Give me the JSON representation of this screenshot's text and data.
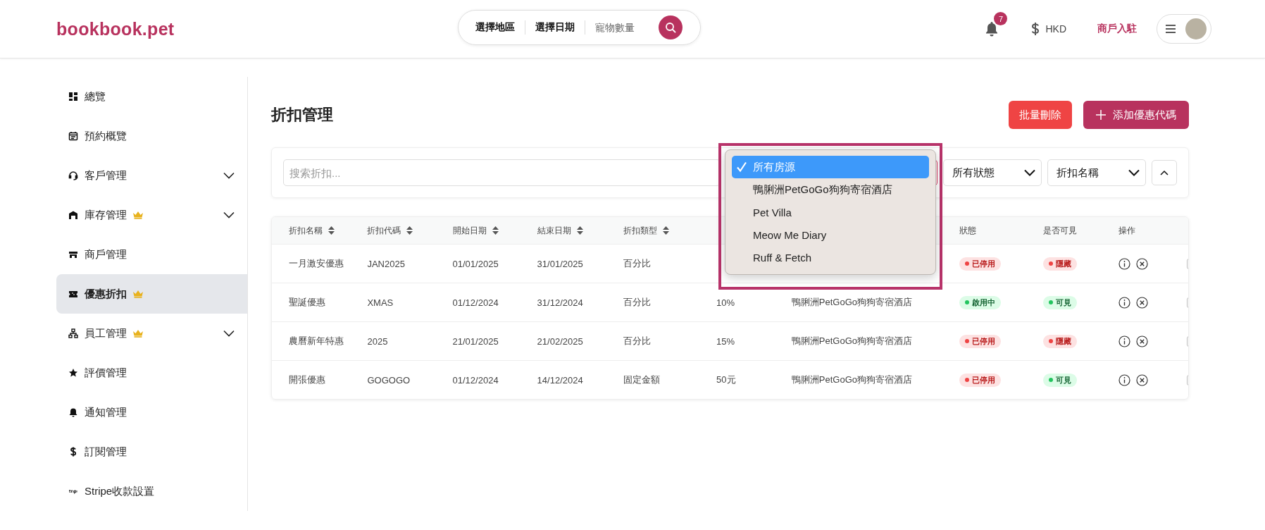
{
  "header": {
    "logo": "bookbook.pet",
    "search": {
      "region": "選擇地區",
      "date": "選擇日期",
      "pets_placeholder": "寵物數量"
    },
    "notifications": {
      "count": "7"
    },
    "currency": "HKD",
    "merchant_link": "商戶入駐"
  },
  "sidebar": {
    "items": [
      {
        "label": "總覽",
        "premium": false,
        "expandable": false,
        "selected": false
      },
      {
        "label": "預約概覽",
        "premium": false,
        "expandable": false,
        "selected": false
      },
      {
        "label": "客戶管理",
        "premium": false,
        "expandable": true,
        "selected": false
      },
      {
        "label": "庫存管理",
        "premium": true,
        "expandable": true,
        "selected": false
      },
      {
        "label": "商戶管理",
        "premium": false,
        "expandable": false,
        "selected": false
      },
      {
        "label": "優惠折扣",
        "premium": true,
        "expandable": false,
        "selected": true
      },
      {
        "label": "員工管理",
        "premium": true,
        "expandable": true,
        "selected": false
      },
      {
        "label": "評價管理",
        "premium": false,
        "expandable": false,
        "selected": false
      },
      {
        "label": "通知管理",
        "premium": false,
        "expandable": false,
        "selected": false
      },
      {
        "label": "訂閱管理",
        "premium": false,
        "expandable": false,
        "selected": false
      },
      {
        "label": "Stripe收款設置",
        "premium": false,
        "expandable": false,
        "selected": false
      }
    ]
  },
  "page": {
    "title": "折扣管理",
    "bulk_delete_button": "批量刪除",
    "add_button": "添加優惠代碼"
  },
  "filters": {
    "search_placeholder": "搜索折扣...",
    "status_select": "所有狀態",
    "sort_select": "折扣名稱"
  },
  "property_dropdown": {
    "options": [
      {
        "label": "所有房源",
        "selected": true
      },
      {
        "label": "鴨脷洲PetGoGo狗狗寄宿酒店",
        "selected": false
      },
      {
        "label": "Pet Villa",
        "selected": false
      },
      {
        "label": "Meow Me Diary",
        "selected": false
      },
      {
        "label": "Ruff & Fetch",
        "selected": false
      }
    ]
  },
  "table": {
    "columns": [
      {
        "label": "折扣名稱",
        "sortable": true
      },
      {
        "label": "折扣代碼",
        "sortable": true
      },
      {
        "label": "開始日期",
        "sortable": true
      },
      {
        "label": "結束日期",
        "sortable": true
      },
      {
        "label": "折扣類型",
        "sortable": true
      },
      {
        "label": "狀態",
        "sortable": false
      },
      {
        "label": "是否可見",
        "sortable": false
      },
      {
        "label": "操作",
        "sortable": false
      }
    ],
    "rows": [
      {
        "name": "一月激安優惠",
        "code": "JAN2025",
        "start": "01/01/2025",
        "end": "31/01/2025",
        "type": "百分比",
        "status": {
          "text": "已停用",
          "active": false
        },
        "visibility": {
          "text": "隱藏",
          "visible": false
        },
        "selected": false
      },
      {
        "name": "聖誕優惠",
        "code": "XMAS",
        "start": "01/12/2024",
        "end": "31/12/2024",
        "type": "百分比",
        "value": "10%",
        "property": "鴨脷洲PetGoGo狗狗寄宿酒店",
        "status": {
          "text": "啟用中",
          "active": true
        },
        "visibility": {
          "text": "可見",
          "visible": true
        },
        "selected": false
      },
      {
        "name": "農曆新年特惠",
        "code": "2025",
        "start": "21/01/2025",
        "end": "21/02/2025",
        "type": "百分比",
        "value": "15%",
        "property": "鴨脷洲PetGoGo狗狗寄宿酒店",
        "status": {
          "text": "已停用",
          "active": false
        },
        "visibility": {
          "text": "隱藏",
          "visible": false
        },
        "selected": false
      },
      {
        "name": "開張優惠",
        "code": "GOGOGO",
        "start": "01/12/2024",
        "end": "14/12/2024",
        "type": "固定金額",
        "value": "50元",
        "property": "鴨脷洲PetGoGo狗狗寄宿酒店",
        "status": {
          "text": "已停用",
          "active": false
        },
        "visibility": {
          "text": "可見",
          "visible": true
        },
        "selected": false
      }
    ]
  }
}
